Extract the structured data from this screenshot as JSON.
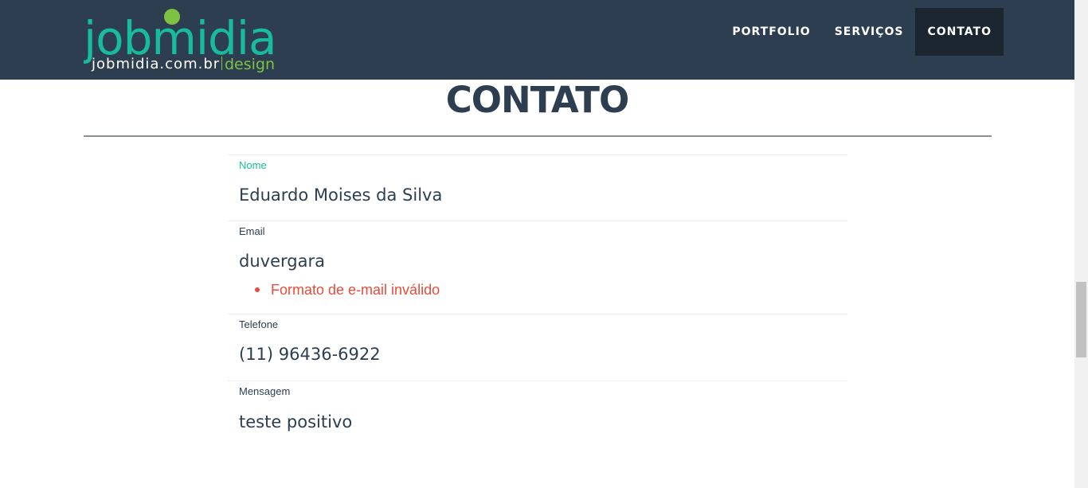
{
  "brand": {
    "logo_main": "jobmidia",
    "logo_url": "jobmidia.com.br",
    "logo_design": "design",
    "colors": {
      "green": "#18bc9c",
      "lime": "#7dc242",
      "navy": "#2c3e50"
    }
  },
  "nav": {
    "items": [
      {
        "label": "PORTFOLIO",
        "active": false
      },
      {
        "label": "SERVIÇOS",
        "active": false
      },
      {
        "label": "CONTATO",
        "active": true
      }
    ]
  },
  "page": {
    "title": "CONTATO"
  },
  "form": {
    "name": {
      "label": "Nome",
      "value": "Eduardo Moises da Silva",
      "focused": true
    },
    "email": {
      "label": "Email",
      "value": "duvergara",
      "errors": [
        "Formato de e-mail inválido"
      ]
    },
    "phone": {
      "label": "Telefone",
      "value": "(11) 96436-6922"
    },
    "message": {
      "label": "Mensagem",
      "value": "teste positivo"
    }
  },
  "colors": {
    "accent": "#18bc9c",
    "error": "#e74c3c",
    "navbar": "#2c3e50",
    "nav_active": "#1a252f"
  }
}
